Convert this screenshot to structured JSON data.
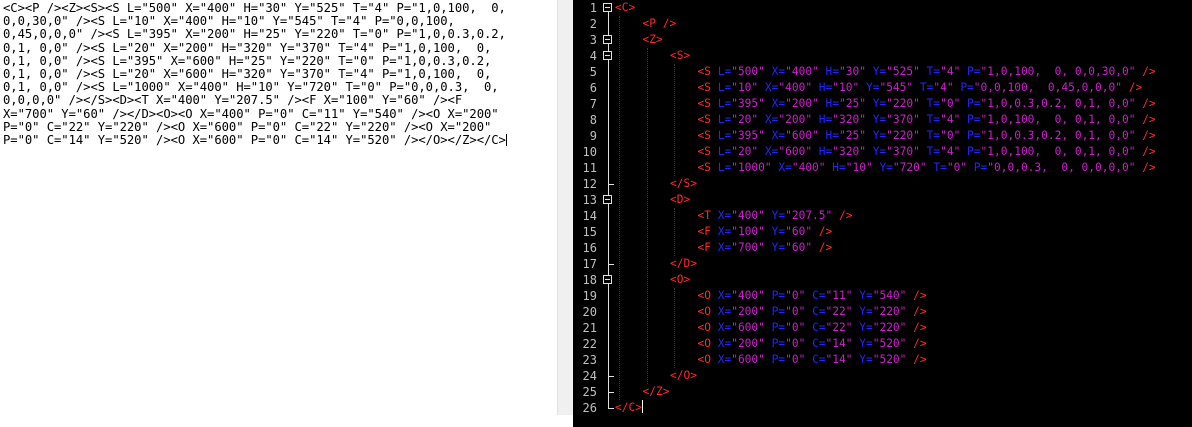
{
  "left_pane": {
    "raw_xml_lines": [
      "<C><P /><Z><S><S L=\"500\" X=\"400\" H=\"30\" Y=\"525\" T=\"4\" P=\"1,0,100,  0,",
      "0,0,30,0\" /><S L=\"10\" X=\"400\" H=\"10\" Y=\"545\" T=\"4\" P=\"0,0,100,",
      "0,45,0,0,0\" /><S L=\"395\" X=\"200\" H=\"25\" Y=\"220\" T=\"0\" P=\"1,0,0.3,0.2,",
      "0,1, 0,0\" /><S L=\"20\" X=\"200\" H=\"320\" Y=\"370\" T=\"4\" P=\"1,0,100,  0,",
      "0,1, 0,0\" /><S L=\"395\" X=\"600\" H=\"25\" Y=\"220\" T=\"0\" P=\"1,0,0.3,0.2,",
      "0,1, 0,0\" /><S L=\"20\" X=\"600\" H=\"320\" Y=\"370\" T=\"4\" P=\"1,0,100,  0,",
      "0,1, 0,0\" /><S L=\"1000\" X=\"400\" H=\"10\" Y=\"720\" T=\"0\" P=\"0,0,0.3,  0,",
      "0,0,0,0\" /></S><D><T X=\"400\" Y=\"207.5\" /><F X=\"100\" Y=\"60\" /><F",
      "X=\"700\" Y=\"60\" /></D><O><O X=\"400\" P=\"0\" C=\"11\" Y=\"540\" /><O X=\"200\"",
      "P=\"0\" C=\"22\" Y=\"220\" /><O X=\"600\" P=\"0\" C=\"22\" Y=\"220\" /><O X=\"200\"",
      "P=\"0\" C=\"14\" Y=\"520\" /><O X=\"600\" P=\"0\" C=\"14\" Y=\"520\" /></O></Z></C>"
    ]
  },
  "editor": {
    "line_numbers": [
      "1",
      "2",
      "3",
      "4",
      "5",
      "6",
      "7",
      "8",
      "9",
      "10",
      "11",
      "12",
      "13",
      "14",
      "15",
      "16",
      "17",
      "18",
      "19",
      "20",
      "21",
      "22",
      "23",
      "24",
      "25",
      "26"
    ],
    "lines": [
      {
        "indent": 0,
        "tokens": [
          [
            "t",
            "<C>"
          ]
        ]
      },
      {
        "indent": 1,
        "tokens": [
          [
            "t",
            "<P />"
          ]
        ]
      },
      {
        "indent": 1,
        "tokens": [
          [
            "t",
            "<Z>"
          ]
        ]
      },
      {
        "indent": 2,
        "tokens": [
          [
            "t",
            "<S>"
          ]
        ]
      },
      {
        "indent": 3,
        "tokens": [
          [
            "t",
            "<S "
          ],
          [
            "a",
            "L="
          ],
          [
            "v",
            "\"500\""
          ],
          [
            "a",
            " X="
          ],
          [
            "v",
            "\"400\""
          ],
          [
            "a",
            " H="
          ],
          [
            "v",
            "\"30\""
          ],
          [
            "a",
            " Y="
          ],
          [
            "v",
            "\"525\""
          ],
          [
            "a",
            " T="
          ],
          [
            "v",
            "\"4\""
          ],
          [
            "a",
            " P="
          ],
          [
            "v",
            "\"1,0,100,  0, 0,0,30,0\""
          ],
          [
            "t",
            " />"
          ]
        ]
      },
      {
        "indent": 3,
        "tokens": [
          [
            "t",
            "<S "
          ],
          [
            "a",
            "L="
          ],
          [
            "v",
            "\"10\""
          ],
          [
            "a",
            " X="
          ],
          [
            "v",
            "\"400\""
          ],
          [
            "a",
            " H="
          ],
          [
            "v",
            "\"10\""
          ],
          [
            "a",
            " Y="
          ],
          [
            "v",
            "\"545\""
          ],
          [
            "a",
            " T="
          ],
          [
            "v",
            "\"4\""
          ],
          [
            "a",
            " P="
          ],
          [
            "v",
            "\"0,0,100,  0,45,0,0,0\""
          ],
          [
            "t",
            " />"
          ]
        ]
      },
      {
        "indent": 3,
        "tokens": [
          [
            "t",
            "<S "
          ],
          [
            "a",
            "L="
          ],
          [
            "v",
            "\"395\""
          ],
          [
            "a",
            " X="
          ],
          [
            "v",
            "\"200\""
          ],
          [
            "a",
            " H="
          ],
          [
            "v",
            "\"25\""
          ],
          [
            "a",
            " Y="
          ],
          [
            "v",
            "\"220\""
          ],
          [
            "a",
            " T="
          ],
          [
            "v",
            "\"0\""
          ],
          [
            "a",
            " P="
          ],
          [
            "v",
            "\"1,0,0.3,0.2, 0,1, 0,0\""
          ],
          [
            "t",
            " />"
          ]
        ]
      },
      {
        "indent": 3,
        "tokens": [
          [
            "t",
            "<S "
          ],
          [
            "a",
            "L="
          ],
          [
            "v",
            "\"20\""
          ],
          [
            "a",
            " X="
          ],
          [
            "v",
            "\"200\""
          ],
          [
            "a",
            " H="
          ],
          [
            "v",
            "\"320\""
          ],
          [
            "a",
            " Y="
          ],
          [
            "v",
            "\"370\""
          ],
          [
            "a",
            " T="
          ],
          [
            "v",
            "\"4\""
          ],
          [
            "a",
            " P="
          ],
          [
            "v",
            "\"1,0,100,  0, 0,1, 0,0\""
          ],
          [
            "t",
            " />"
          ]
        ]
      },
      {
        "indent": 3,
        "tokens": [
          [
            "t",
            "<S "
          ],
          [
            "a",
            "L="
          ],
          [
            "v",
            "\"395\""
          ],
          [
            "a",
            " X="
          ],
          [
            "v",
            "\"600\""
          ],
          [
            "a",
            " H="
          ],
          [
            "v",
            "\"25\""
          ],
          [
            "a",
            " Y="
          ],
          [
            "v",
            "\"220\""
          ],
          [
            "a",
            " T="
          ],
          [
            "v",
            "\"0\""
          ],
          [
            "a",
            " P="
          ],
          [
            "v",
            "\"1,0,0.3,0.2, 0,1, 0,0\""
          ],
          [
            "t",
            " />"
          ]
        ]
      },
      {
        "indent": 3,
        "tokens": [
          [
            "t",
            "<S "
          ],
          [
            "a",
            "L="
          ],
          [
            "v",
            "\"20\""
          ],
          [
            "a",
            " X="
          ],
          [
            "v",
            "\"600\""
          ],
          [
            "a",
            " H="
          ],
          [
            "v",
            "\"320\""
          ],
          [
            "a",
            " Y="
          ],
          [
            "v",
            "\"370\""
          ],
          [
            "a",
            " T="
          ],
          [
            "v",
            "\"4\""
          ],
          [
            "a",
            " P="
          ],
          [
            "v",
            "\"1,0,100,  0, 0,1, 0,0\""
          ],
          [
            "t",
            " />"
          ]
        ]
      },
      {
        "indent": 3,
        "tokens": [
          [
            "t",
            "<S "
          ],
          [
            "a",
            "L="
          ],
          [
            "v",
            "\"1000\""
          ],
          [
            "a",
            " X="
          ],
          [
            "v",
            "\"400\""
          ],
          [
            "a",
            " H="
          ],
          [
            "v",
            "\"10\""
          ],
          [
            "a",
            " Y="
          ],
          [
            "v",
            "\"720\""
          ],
          [
            "a",
            " T="
          ],
          [
            "v",
            "\"0\""
          ],
          [
            "a",
            " P="
          ],
          [
            "v",
            "\"0,0,0.3,  0, 0,0,0,0\""
          ],
          [
            "t",
            " />"
          ]
        ]
      },
      {
        "indent": 2,
        "tokens": [
          [
            "t",
            "</S>"
          ]
        ]
      },
      {
        "indent": 2,
        "tokens": [
          [
            "t",
            "<D>"
          ]
        ]
      },
      {
        "indent": 3,
        "tokens": [
          [
            "t",
            "<T "
          ],
          [
            "a",
            "X="
          ],
          [
            "v",
            "\"400\""
          ],
          [
            "a",
            " Y="
          ],
          [
            "v",
            "\"207.5\""
          ],
          [
            "t",
            " />"
          ]
        ]
      },
      {
        "indent": 3,
        "tokens": [
          [
            "t",
            "<F "
          ],
          [
            "a",
            "X="
          ],
          [
            "v",
            "\"100\""
          ],
          [
            "a",
            " Y="
          ],
          [
            "v",
            "\"60\""
          ],
          [
            "t",
            " />"
          ]
        ]
      },
      {
        "indent": 3,
        "tokens": [
          [
            "t",
            "<F "
          ],
          [
            "a",
            "X="
          ],
          [
            "v",
            "\"700\""
          ],
          [
            "a",
            " Y="
          ],
          [
            "v",
            "\"60\""
          ],
          [
            "t",
            " />"
          ]
        ]
      },
      {
        "indent": 2,
        "tokens": [
          [
            "t",
            "</D>"
          ]
        ]
      },
      {
        "indent": 2,
        "tokens": [
          [
            "t",
            "<O>"
          ]
        ]
      },
      {
        "indent": 3,
        "tokens": [
          [
            "t",
            "<O "
          ],
          [
            "a",
            "X="
          ],
          [
            "v",
            "\"400\""
          ],
          [
            "a",
            " P="
          ],
          [
            "v",
            "\"0\""
          ],
          [
            "a",
            " C="
          ],
          [
            "v",
            "\"11\""
          ],
          [
            "a",
            " Y="
          ],
          [
            "v",
            "\"540\""
          ],
          [
            "t",
            " />"
          ]
        ]
      },
      {
        "indent": 3,
        "tokens": [
          [
            "t",
            "<O "
          ],
          [
            "a",
            "X="
          ],
          [
            "v",
            "\"200\""
          ],
          [
            "a",
            " P="
          ],
          [
            "v",
            "\"0\""
          ],
          [
            "a",
            " C="
          ],
          [
            "v",
            "\"22\""
          ],
          [
            "a",
            " Y="
          ],
          [
            "v",
            "\"220\""
          ],
          [
            "t",
            " />"
          ]
        ]
      },
      {
        "indent": 3,
        "tokens": [
          [
            "t",
            "<O "
          ],
          [
            "a",
            "X="
          ],
          [
            "v",
            "\"600\""
          ],
          [
            "a",
            " P="
          ],
          [
            "v",
            "\"0\""
          ],
          [
            "a",
            " C="
          ],
          [
            "v",
            "\"22\""
          ],
          [
            "a",
            " Y="
          ],
          [
            "v",
            "\"220\""
          ],
          [
            "t",
            " />"
          ]
        ]
      },
      {
        "indent": 3,
        "tokens": [
          [
            "t",
            "<O "
          ],
          [
            "a",
            "X="
          ],
          [
            "v",
            "\"200\""
          ],
          [
            "a",
            " P="
          ],
          [
            "v",
            "\"0\""
          ],
          [
            "a",
            " C="
          ],
          [
            "v",
            "\"14\""
          ],
          [
            "a",
            " Y="
          ],
          [
            "v",
            "\"520\""
          ],
          [
            "t",
            " />"
          ]
        ]
      },
      {
        "indent": 3,
        "tokens": [
          [
            "t",
            "<O "
          ],
          [
            "a",
            "X="
          ],
          [
            "v",
            "\"600\""
          ],
          [
            "a",
            " P="
          ],
          [
            "v",
            "\"0\""
          ],
          [
            "a",
            " C="
          ],
          [
            "v",
            "\"14\""
          ],
          [
            "a",
            " Y="
          ],
          [
            "v",
            "\"520\""
          ],
          [
            "t",
            " />"
          ]
        ]
      },
      {
        "indent": 2,
        "tokens": [
          [
            "t",
            "</O>"
          ]
        ]
      },
      {
        "indent": 1,
        "tokens": [
          [
            "t",
            "</Z>"
          ]
        ]
      },
      {
        "indent": 0,
        "tokens": [
          [
            "t",
            "</C>"
          ]
        ]
      }
    ],
    "colors": {
      "background": "#000000",
      "line_numbers": "#c0c0c0",
      "tag": "#ff2a2a",
      "attribute": "#2424ff",
      "value": "#cc1fcc"
    }
  }
}
